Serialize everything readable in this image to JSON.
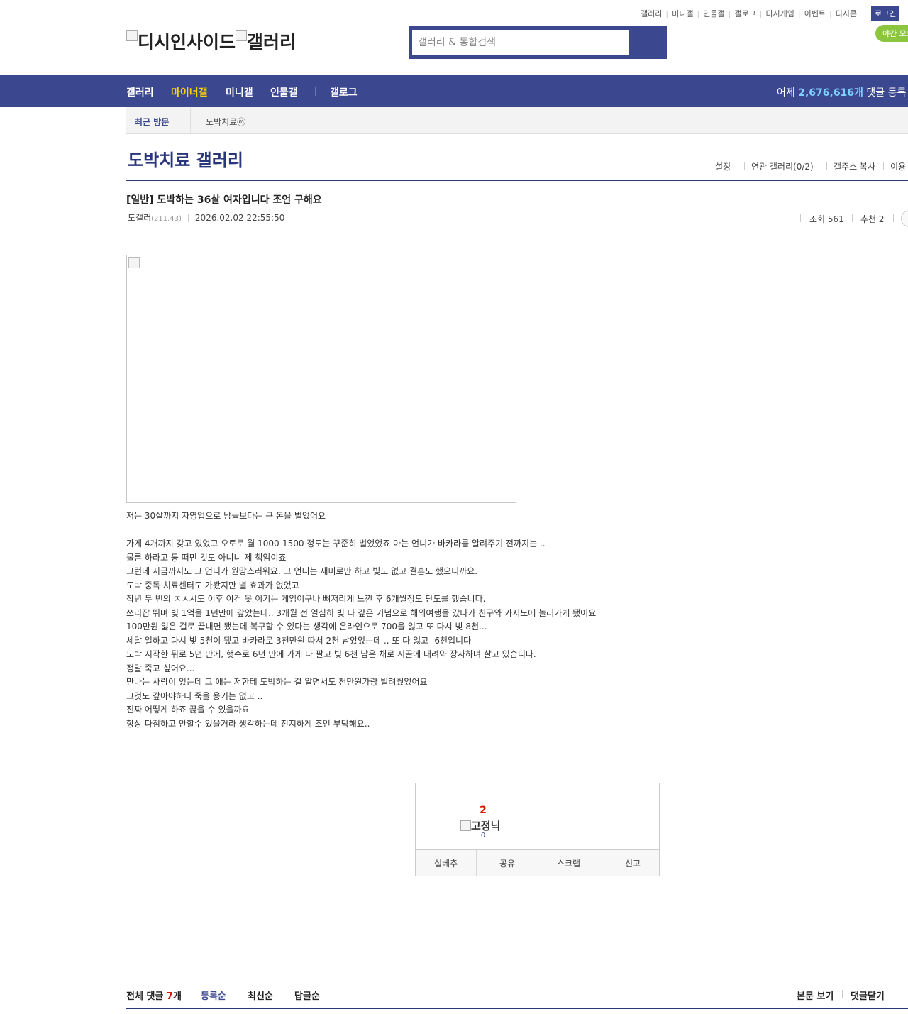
{
  "util_links": [
    "갤러리",
    "미니갤",
    "인물갤",
    "갤로그",
    "디시게임",
    "이벤트",
    "디시콘"
  ],
  "login_label": "로그인",
  "night_mode_label": "야간 모드",
  "logo": {
    "alt_1": "디시인사이드",
    "alt_2": "갤러리"
  },
  "search": {
    "placeholder": "갤러리 & 통합검색"
  },
  "gnb": {
    "items": [
      "갤러리",
      "마이너갤",
      "미니갤",
      "인물갤",
      "갤로그"
    ],
    "count_prefix": "어제",
    "count_value": "2,676,616개",
    "count_suffix": "댓글 등록"
  },
  "recent": {
    "label": "최근 방문",
    "gallery": "도박치료ⓜ"
  },
  "gallery": {
    "title": "도박치료 갤러리",
    "menu": [
      "설정",
      "연관 갤러리(0/2)",
      "갤주소 복사",
      "이용"
    ]
  },
  "post": {
    "title": "[일반] 도박하는 36살 여자입니다 조언 구해요",
    "author": "도갤러",
    "ip": "(211.43)",
    "date": "2026.02.02 22:55:50",
    "views_label": "조회 561",
    "recommend_label": "추천 2",
    "body": [
      "저는 30살까지 자영업으로 남들보다는 큰 돈을 벌었어요",
      "",
      "가게 4개까지 갖고 있었고 오토로 월 1000-1500 정도는 꾸준히 벌었었죠 아는 언니가 바카라를 알려주기 전까지는 ..",
      "물론 하라고 등 떠민 것도 아니니 제 책임이죠",
      "그런데 지금까지도 그 언니가 원망스러워요. 그 언니는 재미로만 하고 빚도 없고 결혼도 했으니까요.",
      "도박 중독 치료센터도 가봤지만 별 효과가 없었고",
      "작년 두 번의 ㅈㅅ시도 이후 이건 못 이기는 게임이구나 뼈저리게 느낀 후 6개월정도 단도를 했습니다.",
      "쓰리잡 뛰며 빚 1억을 1년만에 갚았는데.. 3개월 전 열심히 빚 다 갚은 기념으로 해외여행을 갔다가 친구와 카지노에 놀러가게 됐어요",
      "100만원 잃은 걸로 끝내면 됐는데 복구할 수 있다는 생각에 온라인으로 700을 잃고 또 다시 빚 8천...",
      "세달 일하고 다시 빚 5천이 됐고 바카라로 3천만원 따서 2천 남았었는데 .. 또 다 잃고 -6천입니다",
      "도박 시작한 뒤로 5년 만에, 햇수로 6년 만에 가게 다 팔고 빚 6천 남은 채로 시골에 내려와 장사하며 살고 있습니다.",
      "정말 죽고 싶어요...",
      "만나는 사람이 있는데 그 애는 저한테 도박하는 걸 알면서도 천만원가량 빌려줬었어요",
      "그것도 갚아야하니 죽을 용기는 없고 ..",
      "진짜 어떻게 하죠 끊을 수 있을까요",
      "항상 다짐하고 안할수 있을거라 생각하는데 진지하게 조언 부탁해요.."
    ]
  },
  "recommend_box": {
    "count": "2",
    "fixed_label": "고정닉",
    "fixed_count": "0",
    "buttons": [
      "실베추",
      "공유",
      "스크랩",
      "신고"
    ]
  },
  "comments": {
    "total_prefix": "전체 댓글",
    "total_count": "7",
    "total_suffix": "개",
    "sort": [
      "등록순",
      "최신순",
      "답글순"
    ],
    "right": [
      "본문 보기",
      "댓글닫기"
    ]
  },
  "colors": {
    "brand": "#3b4890",
    "title": "#29367c",
    "accent": "#ffd200",
    "red": "#d31900",
    "green": "#8cc63f"
  }
}
